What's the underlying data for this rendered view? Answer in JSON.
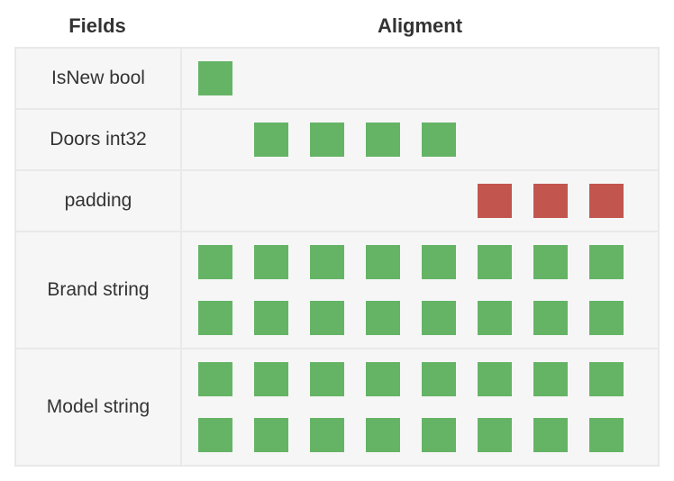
{
  "headers": {
    "fields": "Fields",
    "alignment": "Aligment"
  },
  "rows": [
    {
      "label": "IsNew bool",
      "bytes": [
        "used",
        "empty",
        "empty",
        "empty",
        "empty",
        "empty",
        "empty",
        "empty"
      ]
    },
    {
      "label": "Doors int32",
      "bytes": [
        "empty",
        "used",
        "used",
        "used",
        "used",
        "empty",
        "empty",
        "empty"
      ]
    },
    {
      "label": "padding",
      "bytes": [
        "empty",
        "empty",
        "empty",
        "empty",
        "empty",
        "pad",
        "pad",
        "pad"
      ]
    },
    {
      "label": "Brand string",
      "bytes": [
        "used",
        "used",
        "used",
        "used",
        "used",
        "used",
        "used",
        "used",
        "used",
        "used",
        "used",
        "used",
        "used",
        "used",
        "used",
        "used"
      ]
    },
    {
      "label": "Model string",
      "bytes": [
        "used",
        "used",
        "used",
        "used",
        "used",
        "used",
        "used",
        "used",
        "used",
        "used",
        "used",
        "used",
        "used",
        "used",
        "used",
        "used"
      ]
    }
  ],
  "colors": {
    "used": "#65b466",
    "pad": "#c2564e"
  }
}
